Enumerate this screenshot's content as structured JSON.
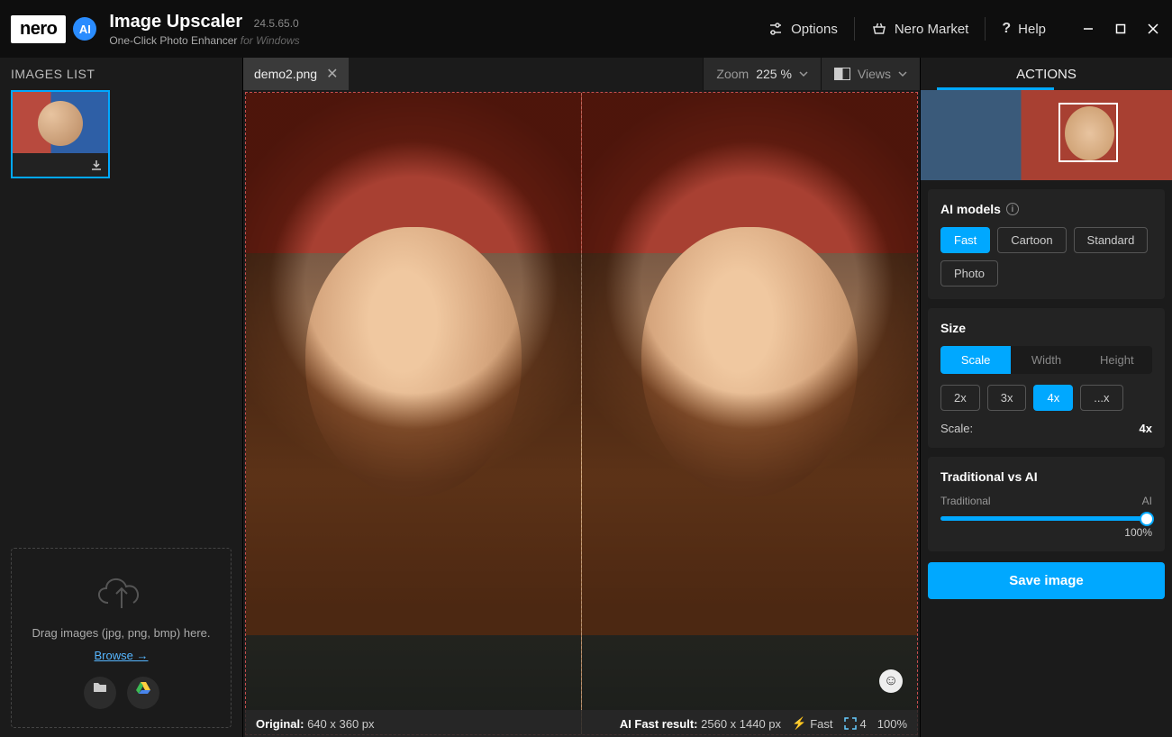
{
  "header": {
    "logo_text": "nero",
    "logo_ai": "AI",
    "title": "Image Upscaler",
    "version": "24.5.65.0",
    "subtitle": "One-Click Photo Enhancer",
    "subtitle_suffix": "for Windows",
    "options_label": "Options",
    "market_label": "Nero Market",
    "help_label": "Help"
  },
  "sidebar": {
    "images_list_label": "IMAGES LIST",
    "dropzone_text": "Drag images (jpg, png, bmp) here.",
    "browse_label": "Browse →"
  },
  "tabs": {
    "current": "demo2.png",
    "zoom_label": "Zoom",
    "zoom_value": "225 %",
    "views_label": "Views"
  },
  "status": {
    "original_label": "Original:",
    "original_dims": "640 x 360 px",
    "result_label": "AI Fast result:",
    "result_dims": "2560 x 1440 px",
    "speed_label": "Fast",
    "scale_badge": "4",
    "progress": "100%"
  },
  "actions": {
    "header": "ACTIONS",
    "ai_models_label": "AI models",
    "models": [
      "Fast",
      "Cartoon",
      "Standard",
      "Photo"
    ],
    "model_active": "Fast",
    "size_label": "Size",
    "size_tabs": [
      "Scale",
      "Width",
      "Height"
    ],
    "size_tab_active": "Scale",
    "scale_options": [
      "2x",
      "3x",
      "4x",
      "...x"
    ],
    "scale_active": "4x",
    "scale_kv_label": "Scale:",
    "scale_kv_value": "4x",
    "trad_vs_ai_label": "Traditional vs AI",
    "trad_label": "Traditional",
    "ai_label": "AI",
    "slider_percent": "100%",
    "save_label": "Save image"
  }
}
